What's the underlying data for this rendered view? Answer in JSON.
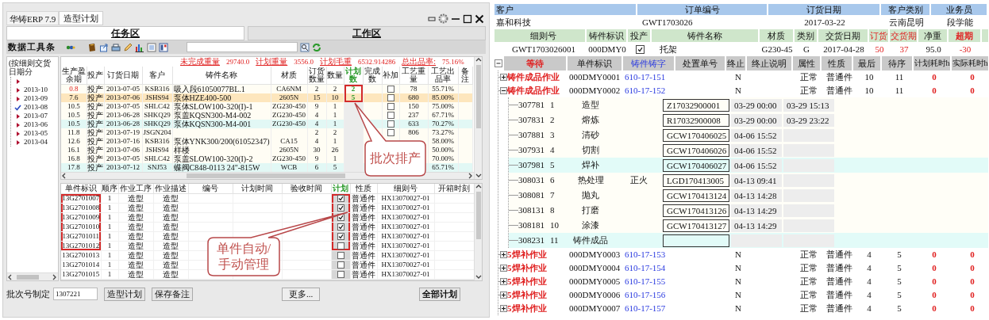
{
  "left_window": {
    "app_title": "华铸ERP 7.9",
    "tabs": [
      {
        "label": "造型计划",
        "selected": true
      }
    ],
    "sections": [
      {
        "label": "任务区",
        "selected": true
      },
      {
        "label": "工作区",
        "selected": false
      }
    ],
    "toolbar": {
      "label": "数据工具条"
    },
    "date_tree": {
      "title": "(按细则交货日期分",
      "items": [
        {
          "checked": false
        },
        {
          "label": "2013-10",
          "checked": false
        },
        {
          "label": "2013-09",
          "checked": false
        },
        {
          "label": "2013-08",
          "checked": true
        },
        {
          "label": "2013-07",
          "checked": false
        },
        {
          "label": "2013-06",
          "checked": false
        },
        {
          "label": "2013-05",
          "checked": false
        },
        {
          "label": "2013-04",
          "checked": false
        }
      ]
    },
    "summary": [
      {
        "label": "未完成重量",
        "value": "29740.0"
      },
      {
        "label": "计划重量",
        "value": "3556.0"
      },
      {
        "label": "计划毛重",
        "value": "6532.914286"
      },
      {
        "label": "总出品率:",
        "value": "75.16%"
      }
    ],
    "orders": {
      "columns": [
        "生产盈余期",
        "投产",
        "订货日期",
        "客户",
        "铸件名称",
        "材质",
        "订货数量",
        "数量",
        "计划数",
        "完成数",
        "补加",
        "工艺重量",
        "工艺出品率",
        "备注"
      ],
      "rows": [
        {
          "surplus": "0.8",
          "warning": true,
          "status": "投产",
          "order_date": "2013-07-05",
          "customer": "KSB316",
          "name": "吸入段61050077BL.1",
          "material": "CA6NM",
          "order_qty": "2",
          "qty": "2",
          "plan_qty": "2",
          "plan_framed": true,
          "addition": false,
          "process_weight": "78",
          "yield": "55.71%",
          "color": "#fffdf4"
        },
        {
          "surplus": "7.6",
          "warning": false,
          "status": "投产",
          "order_date": "2013-07-06",
          "customer": "JSHS94",
          "name": "泵体HZE400-500",
          "material": "2605N",
          "order_qty": "15",
          "qty": "10",
          "plan_qty": "5",
          "plan_framed": true,
          "addition": false,
          "process_weight": "680",
          "yield": "85.00%",
          "color": "#fde6bd"
        },
        {
          "surplus": "10.5",
          "warning": false,
          "status": "投产",
          "order_date": "2013-07-05",
          "customer": "SHLC42",
          "name": "泵体SLOW100-320(I)-1",
          "material": "ZG230-450",
          "order_qty": "9",
          "qty": "1",
          "plan_framed": false,
          "addition": false,
          "process_weight": "150",
          "yield": "75.00%",
          "color": "#fffdf4"
        },
        {
          "surplus": "10.5",
          "warning": false,
          "status": "投产",
          "order_date": "2013-06-28",
          "customer": "SHKQ29",
          "name": "泵盖KQSN300-M4-002",
          "material": "ZG230-450",
          "order_qty": "4",
          "qty": "1",
          "plan_framed": false,
          "addition": false,
          "process_weight": "237",
          "yield": "67.71%",
          "color": "#fffdf4"
        },
        {
          "surplus": "10.5",
          "warning": false,
          "status": "投产",
          "order_date": "2013-06-28",
          "customer": "SHKQ29",
          "name": "泵体KQSN300-M4-001",
          "material": "ZG230-450",
          "order_qty": "4",
          "qty": "1",
          "plan_framed": false,
          "addition": false,
          "process_weight": "633",
          "yield": "70.27%",
          "color": "#e2f8f5"
        },
        {
          "surplus": "11.8",
          "warning": false,
          "status": "投产",
          "order_date": "2013-07-19",
          "customer": "JSGN204",
          "order_qty": "2",
          "qty": "2",
          "plan_framed": false,
          "addition": false,
          "process_weight": "806",
          "yield": "73.27%",
          "color": "#fffdf4"
        },
        {
          "surplus": "12.6",
          "warning": false,
          "status": "投产",
          "order_date": "2013-07-16",
          "customer": "KSB316",
          "name": "泵体YNK300/200(61052347)",
          "material": "CA15",
          "order_qty": "4",
          "qty": "1",
          "plan_framed": false,
          "yield": "58.00%",
          "color": "#fffdf4"
        },
        {
          "surplus": "16.1",
          "warning": false,
          "status": "投产",
          "order_date": "2013-07-06",
          "customer": "JSHS94",
          "name": "样楼",
          "material": "2605N",
          "order_qty": "30",
          "qty": "26",
          "plan_framed": false,
          "yield": "50.00%",
          "color": "#fffdf4"
        },
        {
          "surplus": "16.8",
          "warning": false,
          "status": "投产",
          "order_date": "2013-07-05",
          "customer": "SHLC42",
          "name": "泵盖SLOW100-320(I)-2",
          "material": "ZG230-450",
          "order_qty": "9",
          "qty": "1",
          "plan_framed": false,
          "yield": "70.00%",
          "color": "#fffdf4"
        },
        {
          "surplus": "17.8",
          "warning": false,
          "status": "投产",
          "order_date": "2013-07-12",
          "customer": "SNJ53",
          "name": "蝶阀C848-0113 24\"-815W",
          "material": "WCB",
          "order_qty": "6",
          "qty": "5",
          "plan_framed": false,
          "yield": "65.71%",
          "color": "#e2f8f5"
        }
      ]
    },
    "pieces": {
      "columns": [
        "单件标识",
        "顺序",
        "作业工序",
        "作业描述",
        "编号",
        "计划时间",
        "验收时间",
        "计划",
        "性质",
        "细则号",
        "开箱时刻"
      ],
      "rows": [
        {
          "id": "13G2701007",
          "seq": "1",
          "process": "造型",
          "desc": "造型",
          "plan": true,
          "framed": true,
          "nature": "普通件",
          "detail_no": "HX13070027-01"
        },
        {
          "id": "13G2701008",
          "seq": "1",
          "process": "造型",
          "desc": "造型",
          "plan": true,
          "framed": true,
          "nature": "普通件",
          "detail_no": "HX13070027-01"
        },
        {
          "id": "13G2701009",
          "seq": "1",
          "process": "造型",
          "desc": "造型",
          "plan": true,
          "framed": true,
          "nature": "普通件",
          "detail_no": "HX13070027-01"
        },
        {
          "id": "13G2701010",
          "seq": "1",
          "process": "造型",
          "desc": "造型",
          "plan": true,
          "framed": true,
          "nature": "普通件",
          "detail_no": "HX13070027-01"
        },
        {
          "id": "13G2701011",
          "seq": "1",
          "process": "造型",
          "desc": "造型",
          "plan": true,
          "framed": true,
          "nature": "普通件",
          "detail_no": "HX13070027-01"
        },
        {
          "id": "13G2701012",
          "seq": "1",
          "process": "造型",
          "desc": "造型",
          "plan": false,
          "framed": true,
          "nature": "普通件",
          "detail_no": "HX13070027-01"
        },
        {
          "id": "13G2701013",
          "seq": "1",
          "process": "造型",
          "desc": "造型",
          "plan": false,
          "framed": false,
          "nature": "普通件",
          "detail_no": "HX13070027-01"
        },
        {
          "id": "13G2701014",
          "seq": "1",
          "process": "造型",
          "desc": "造型",
          "plan": false,
          "framed": false,
          "nature": "普通件",
          "detail_no": "HX13070027-01"
        },
        {
          "id": "13G2701015",
          "seq": "1",
          "process": "造型",
          "desc": "造型",
          "plan": false,
          "framed": false,
          "nature": "普通件",
          "detail_no": "HX13070027-01"
        }
      ]
    },
    "batch": {
      "label": "批次号制定",
      "value": "1307221"
    },
    "buttons": [
      "造型计划",
      "保存备注",
      "更多...",
      "全部计划"
    ],
    "callouts": [
      {
        "text": "批次排产"
      },
      {
        "text": "单件自动/手动管理"
      }
    ]
  },
  "right_window": {
    "order": {
      "columns": [
        "客户",
        "订单编号",
        "订货日期",
        "客户类别",
        "业务员"
      ],
      "values": [
        "嘉和科技",
        "GWT1703026",
        "2017-03-22",
        "云南昆明",
        "段学能"
      ]
    },
    "detail": {
      "columns": [
        "细则号",
        "铸件标识",
        "投产",
        "铸件名称",
        "材质",
        "类别",
        "交货日期",
        "订货",
        "交货期",
        "净重",
        "超期"
      ],
      "rows": [
        {
          "detail_no": "GWT1703026001",
          "casting_id": "000DMY0",
          "in_production": true,
          "name": "托架",
          "material": "G230-45",
          "category": "G",
          "delivery_date": "2017-04-28",
          "ordered": "50",
          "delivery_days": "37",
          "net_weight": "95.0",
          "overdue": "-30",
          "expanded": true
        }
      ]
    },
    "jobs": {
      "columns": [
        "等待",
        "单件标识",
        "铸件铸字",
        "处置单号",
        "终止",
        "终止说明",
        "属性",
        "性质",
        "最后",
        "待序",
        "计划耗时h",
        "实际耗时h"
      ],
      "rows": [
        {
          "status": "铸件成品作业",
          "id": "000DMY0001",
          "mark": "610-17-151",
          "terminated": "N",
          "attr": "正常",
          "nature": "普通件",
          "last": "10",
          "wait_seq": "11",
          "plan_hours": "0",
          "actual_hours": "0",
          "expanded": false
        },
        {
          "status": "铸件成品作业",
          "id": "000DMY0002",
          "mark": "610-17-152",
          "terminated": "N",
          "attr": "正常",
          "nature": "普通件",
          "last": "10",
          "wait_seq": "11",
          "plan_hours": "0",
          "actual_hours": "0",
          "expanded": true,
          "children": [
            {
              "id": "307781",
              "seq": "1",
              "name": "造型",
              "disposal_no": "Z17032900001",
              "start": "03-29 00:00",
              "end": "03-29 15:13",
              "selected": false
            },
            {
              "id": "307831",
              "seq": "2",
              "name": "熔炼",
              "disposal_no": "R17032900008",
              "start": "03-29 00:00",
              "end": "03-29 23:22",
              "selected": false
            },
            {
              "id": "307881",
              "seq": "3",
              "name": "清砂",
              "disposal_no": "GCW170406025",
              "start": "04-06 15:52",
              "selected": false
            },
            {
              "id": "307931",
              "seq": "4",
              "name": "切割",
              "disposal_no": "GCW170406026",
              "start": "04-06 15:52",
              "selected": false
            },
            {
              "id": "307981",
              "seq": "5",
              "name": "焊补",
              "disposal_no": "GCW170406027",
              "start": "04-06 15:52",
              "selected": true
            },
            {
              "id": "308031",
              "seq": "6",
              "name": "热处理",
              "desc": "正火",
              "disposal_no": "LGD170413005",
              "start": "04-13 09:41",
              "selected": false
            },
            {
              "id": "308081",
              "seq": "7",
              "name": "抛丸",
              "disposal_no": "GCW170413124",
              "start": "04-13 14:28",
              "selected": false
            },
            {
              "id": "308131",
              "seq": "8",
              "name": "打磨",
              "disposal_no": "GCW170413126",
              "start": "04-13 14:29",
              "selected": false
            },
            {
              "id": "308181",
              "seq": "10",
              "name": "涂漆",
              "disposal_no": "GCW170413127",
              "start": "04-13 14:29",
              "selected": false
            },
            {
              "id": "308231",
              "seq": "11",
              "name": "铸件成品",
              "selected": true
            }
          ]
        },
        {
          "status": "5焊补作业",
          "id": "000DMY0003",
          "mark": "610-17-153",
          "terminated": "N",
          "attr": "正常",
          "nature": "普通件",
          "last": "4",
          "wait_seq": "5",
          "plan_hours": "0",
          "actual_hours": "0",
          "expanded": false
        },
        {
          "status": "5焊补作业",
          "id": "000DMY0004",
          "mark": "610-17-154",
          "terminated": "N",
          "attr": "正常",
          "nature": "普通件",
          "last": "4",
          "wait_seq": "5",
          "plan_hours": "0",
          "actual_hours": "0",
          "expanded": false
        },
        {
          "status": "5焊补作业",
          "id": "000DMY0005",
          "mark": "610-17-155",
          "terminated": "N",
          "attr": "正常",
          "nature": "普通件",
          "last": "4",
          "wait_seq": "5",
          "plan_hours": "0",
          "actual_hours": "0",
          "expanded": false
        },
        {
          "status": "5焊补作业",
          "id": "000DMY0006",
          "mark": "610-17-156",
          "terminated": "N",
          "attr": "正常",
          "nature": "普通件",
          "last": "4",
          "wait_seq": "5",
          "plan_hours": "0",
          "actual_hours": "0",
          "expanded": false
        },
        {
          "status": "5焊补作业",
          "id": "000DMY0007",
          "mark": "610-17-157",
          "terminated": "N",
          "attr": "正常",
          "nature": "普通件",
          "last": "4",
          "wait_seq": "5",
          "plan_hours": "0",
          "actual_hours": "0",
          "expanded": false
        }
      ]
    }
  }
}
